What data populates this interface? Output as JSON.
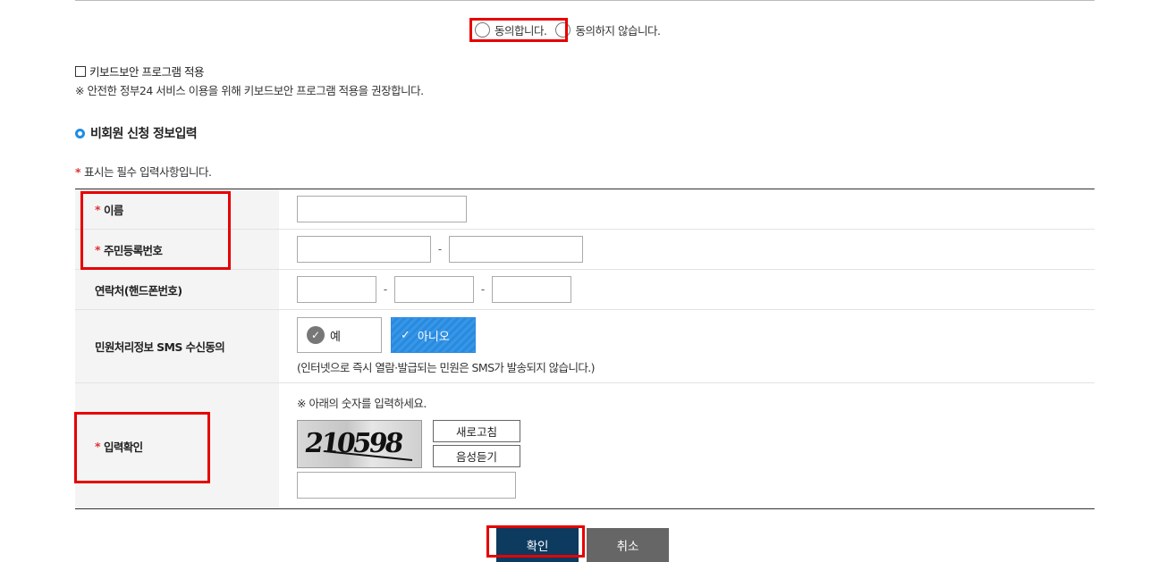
{
  "agreement": {
    "agree_label": "동의합니다.",
    "disagree_label": "동의하지 않습니다."
  },
  "keyboard_security": {
    "checkbox_label": "키보드보안 프로그램 적용",
    "note": "※ 안전한 정부24 서비스 이용을 위해 키보드보안 프로그램 적용을 권장합니다."
  },
  "section": {
    "title": "비회원 신청 정보입력",
    "required_note": "표시는 필수 입력사항입니다.",
    "required_mark": "*"
  },
  "form": {
    "name_label": "이름",
    "rrn_label": "주민등록번호",
    "phone_label": "연락처(핸드폰번호)",
    "sms_label": "민원처리정보 SMS 수신동의",
    "sms_yes": "예",
    "sms_no": "아니오",
    "sms_note": "(인터넷으로 즉시 열람·발급되는 민원은 SMS가 발송되지 않습니다.)",
    "captcha_label": "입력확인",
    "captcha_note": "※ 아래의 숫자를 입력하세요.",
    "captcha_text": "210598",
    "refresh_label": "새로고침",
    "audio_label": "음성듣기",
    "dash": "-"
  },
  "buttons": {
    "confirm": "확인",
    "cancel": "취소"
  },
  "colors": {
    "highlight": "#e60000",
    "accent_blue": "#2b89dc",
    "confirm_bg": "#0d3a5f",
    "cancel_bg": "#666666"
  }
}
